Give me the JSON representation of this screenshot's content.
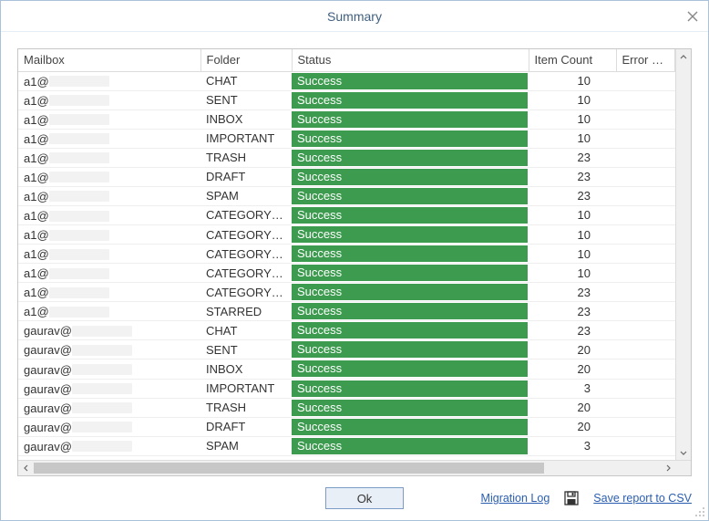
{
  "window": {
    "title": "Summary"
  },
  "columns": {
    "mailbox": "Mailbox",
    "folder": "Folder",
    "status": "Status",
    "item_count": "Item Count",
    "error_details": "Error Details"
  },
  "rows": [
    {
      "mailbox": "a1@",
      "folder": "CHAT",
      "status": "Success",
      "count": "10"
    },
    {
      "mailbox": "a1@",
      "folder": "SENT",
      "status": "Success",
      "count": "10"
    },
    {
      "mailbox": "a1@",
      "folder": "INBOX",
      "status": "Success",
      "count": "10"
    },
    {
      "mailbox": "a1@",
      "folder": "IMPORTANT",
      "status": "Success",
      "count": "10"
    },
    {
      "mailbox": "a1@",
      "folder": "TRASH",
      "status": "Success",
      "count": "23"
    },
    {
      "mailbox": "a1@",
      "folder": "DRAFT",
      "status": "Success",
      "count": "23"
    },
    {
      "mailbox": "a1@",
      "folder": "SPAM",
      "status": "Success",
      "count": "23"
    },
    {
      "mailbox": "a1@",
      "folder": "CATEGORY_...",
      "status": "Success",
      "count": "10"
    },
    {
      "mailbox": "a1@",
      "folder": "CATEGORY_...",
      "status": "Success",
      "count": "10"
    },
    {
      "mailbox": "a1@",
      "folder": "CATEGORY_...",
      "status": "Success",
      "count": "10"
    },
    {
      "mailbox": "a1@",
      "folder": "CATEGORY_...",
      "status": "Success",
      "count": "10"
    },
    {
      "mailbox": "a1@",
      "folder": "CATEGORY_...",
      "status": "Success",
      "count": "23"
    },
    {
      "mailbox": "a1@",
      "folder": "STARRED",
      "status": "Success",
      "count": "23"
    },
    {
      "mailbox": "gaurav@",
      "folder": "CHAT",
      "status": "Success",
      "count": "23"
    },
    {
      "mailbox": "gaurav@",
      "folder": "SENT",
      "status": "Success",
      "count": "20"
    },
    {
      "mailbox": "gaurav@",
      "folder": "INBOX",
      "status": "Success",
      "count": "20"
    },
    {
      "mailbox": "gaurav@",
      "folder": "IMPORTANT",
      "status": "Success",
      "count": "3"
    },
    {
      "mailbox": "gaurav@",
      "folder": "TRASH",
      "status": "Success",
      "count": "20"
    },
    {
      "mailbox": "gaurav@",
      "folder": "DRAFT",
      "status": "Success",
      "count": "20"
    },
    {
      "mailbox": "gaurav@",
      "folder": "SPAM",
      "status": "Success",
      "count": "3"
    }
  ],
  "footer": {
    "ok": "Ok",
    "migration_log": "Migration Log",
    "save_csv": "Save report to CSV"
  }
}
